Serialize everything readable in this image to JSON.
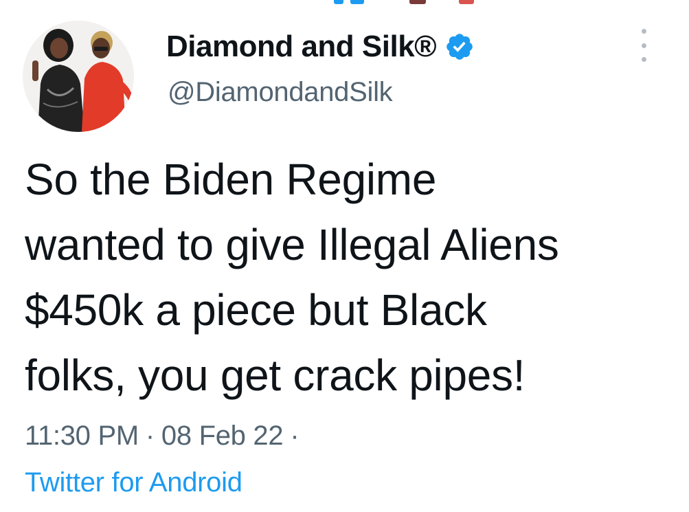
{
  "colors": {
    "text": "#0f1419",
    "secondary_text": "#536471",
    "link": "#1d9bf0",
    "verified_badge": "#1d9bf0"
  },
  "tweet": {
    "author": {
      "display_name": "Diamond and Silk®",
      "handle": "@DiamondandSilk",
      "verified": true,
      "avatar_icon": "profile-avatar"
    },
    "text_lines": [
      "So the Biden Regime",
      "wanted to give Illegal Aliens",
      "$450k a piece but Black",
      "folks, you get crack pipes!"
    ],
    "time": "11:30 PM",
    "date": "08 Feb 22",
    "separator": "·",
    "source": "Twitter for Android",
    "more_icon": "more-options-icon"
  }
}
